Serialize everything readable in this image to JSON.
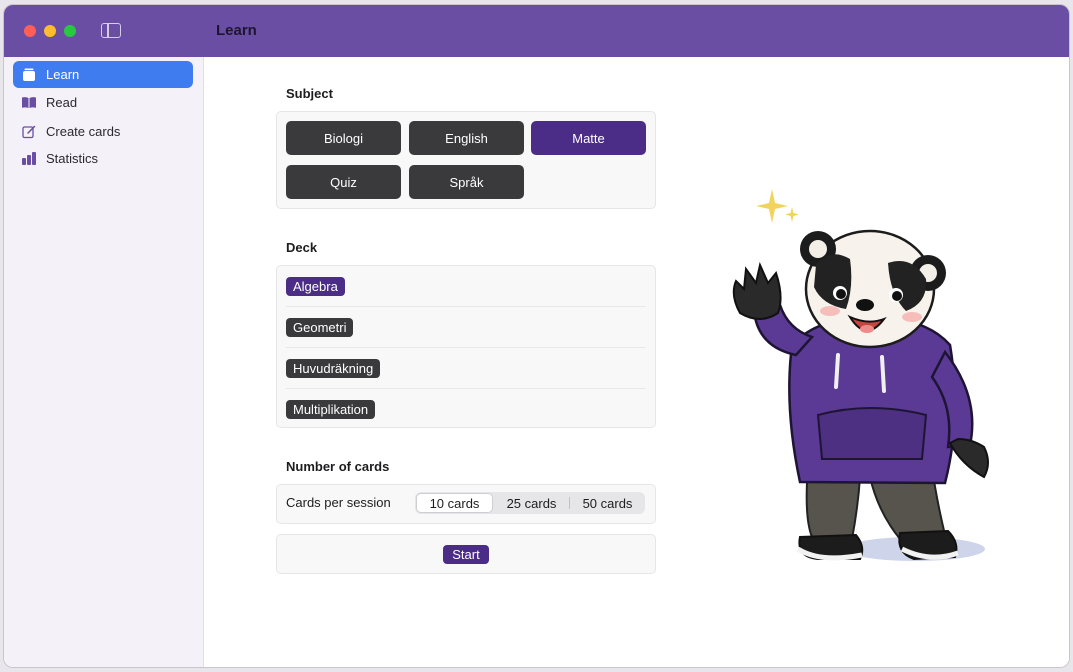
{
  "window": {
    "title": "Learn"
  },
  "sidebar": {
    "items": [
      {
        "label": "Learn",
        "icon": "stack-icon",
        "active": true
      },
      {
        "label": "Read",
        "icon": "book-icon",
        "active": false
      },
      {
        "label": "Create cards",
        "icon": "edit-icon",
        "active": false
      },
      {
        "label": "Statistics",
        "icon": "bar-chart-icon",
        "active": false
      }
    ]
  },
  "subject": {
    "title": "Subject",
    "options": [
      "Biologi",
      "English",
      "Matte",
      "Quiz",
      "Språk"
    ],
    "selected": "Matte"
  },
  "deck": {
    "title": "Deck",
    "items": [
      "Algebra",
      "Geometri",
      "Huvudräkning",
      "Multiplikation"
    ],
    "selected": "Algebra"
  },
  "cards": {
    "title": "Number of cards",
    "label": "Cards per session",
    "options": [
      "10 cards",
      "25 cards",
      "50 cards"
    ],
    "selected": "10 cards"
  },
  "start_label": "Start",
  "colors": {
    "titlebar": "#6a4ea4",
    "accent": "#4b2d87",
    "sidebar_active": "#3f7cf0",
    "button_dark": "#3a3a3c"
  },
  "illustration": "badger-mascot-waving"
}
